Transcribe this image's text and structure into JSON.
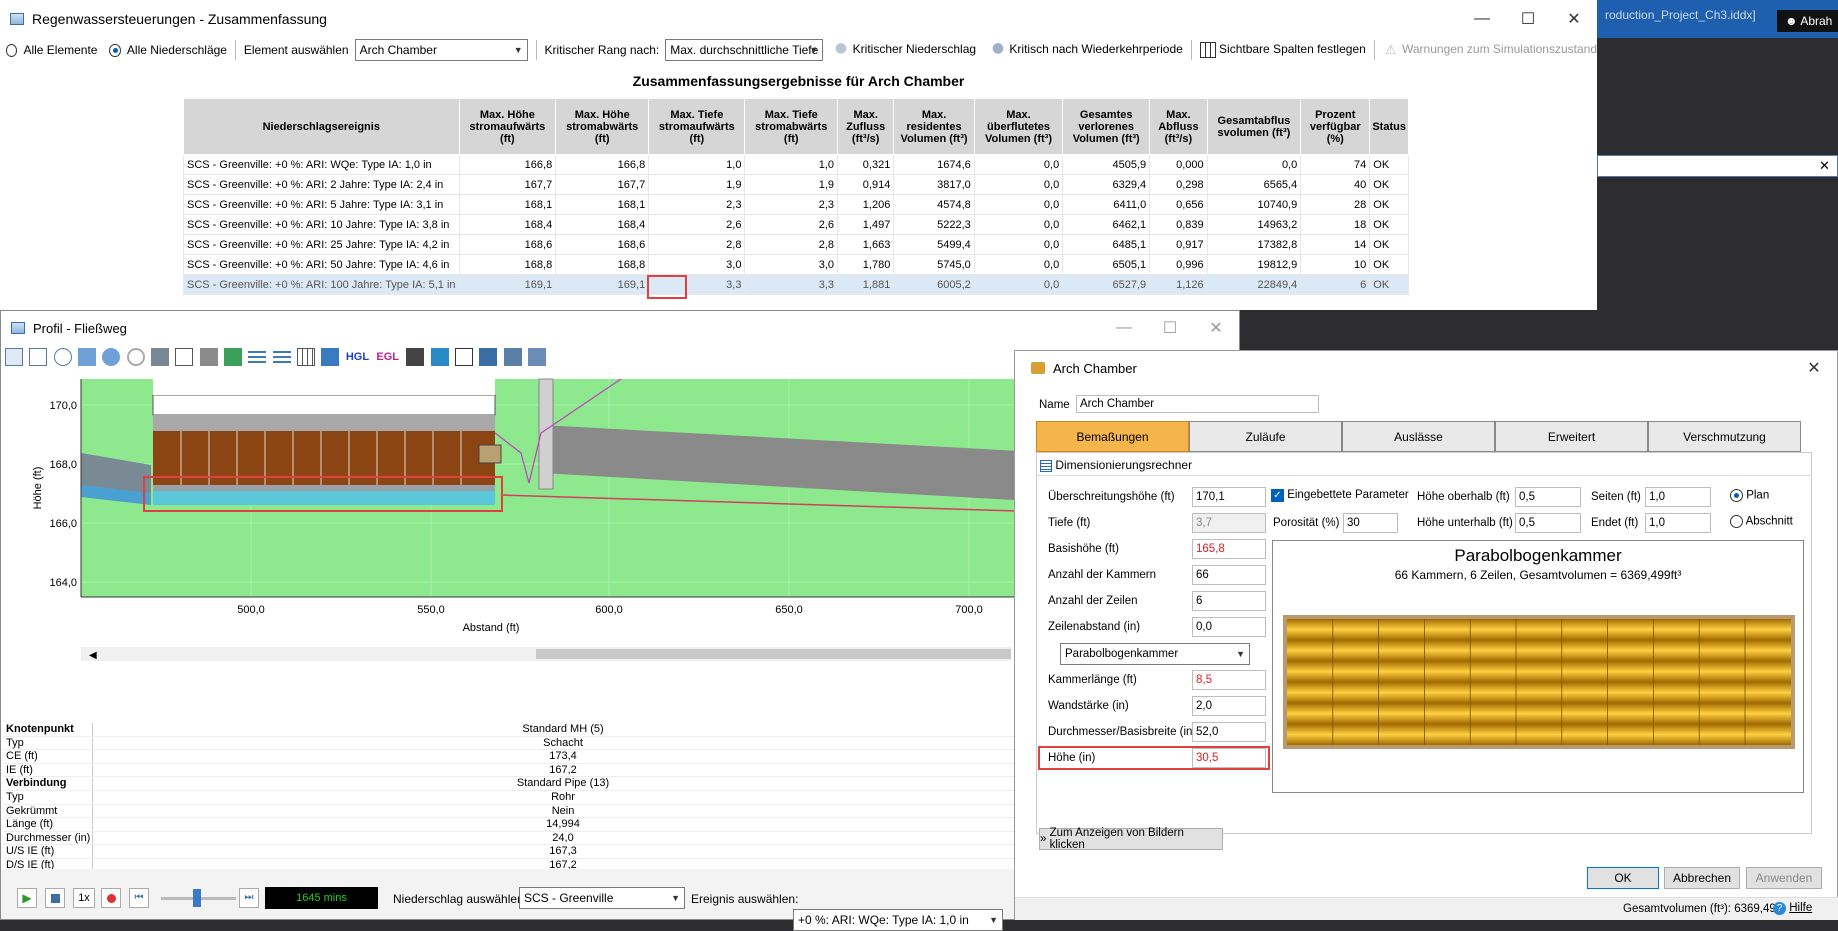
{
  "bg_window": {
    "file_text": "roduction_Project_Ch3.iddx]",
    "user_text": "Abrah"
  },
  "main": {
    "title": "Regenwassersteuerungen - Zusammenfassung",
    "radio_all_elements": "Alle Elemente",
    "radio_all_precip": "Alle Niederschläge",
    "element_label": "Element auswählen",
    "element_value": "Arch Chamber",
    "rank_label": "Kritischer Rang nach:",
    "rank_value": "Max. durchschnittliche Tiefe",
    "critical_precip": "Kritischer Niederschlag",
    "critical_return": "Kritisch nach Wiederkehrperiode",
    "visible_columns": "Sichtbare Spalten festlegen",
    "warnings": "Warnungen zum Simulationszustand",
    "table_title": "Zusammenfassungsergebnisse für Arch Chamber",
    "headers": [
      "Niederschlagsereignis",
      "Max. Höhe stromaufwärts (ft)",
      "Max. Höhe stromabwärts (ft)",
      "Max. Tiefe stromaufwärts (ft)",
      "Max. Tiefe stromabwärts (ft)",
      "Max. Zufluss (ft³/s)",
      "Max. residentes Volumen (ft³)",
      "Max. überflutetes Volumen (ft³)",
      "Gesamtes verlorenes Volumen (ft³)",
      "Max. Abfluss (ft³/s)",
      "Gesamtabflus svolumen (ft³)",
      "Prozent verfügbar (%)",
      "Status"
    ],
    "rows": [
      [
        "SCS - Greenville: +0 %: ARI: WQe: Type IA: 1,0 in",
        "166,8",
        "166,8",
        "1,0",
        "1,0",
        "0,321",
        "1674,6",
        "0,0",
        "4505,9",
        "0,000",
        "0,0",
        "74",
        "OK"
      ],
      [
        "SCS - Greenville: +0 %: ARI: 2 Jahre: Type IA: 2,4 in",
        "167,7",
        "167,7",
        "1,9",
        "1,9",
        "0,914",
        "3817,0",
        "0,0",
        "6329,4",
        "0,298",
        "6565,4",
        "40",
        "OK"
      ],
      [
        "SCS - Greenville: +0 %: ARI: 5 Jahre: Type IA: 3,1 in",
        "168,1",
        "168,1",
        "2,3",
        "2,3",
        "1,206",
        "4574,8",
        "0,0",
        "6411,0",
        "0,656",
        "10740,9",
        "28",
        "OK"
      ],
      [
        "SCS - Greenville: +0 %: ARI: 10 Jahre: Type IA: 3,8 in",
        "168,4",
        "168,4",
        "2,6",
        "2,6",
        "1,497",
        "5222,3",
        "0,0",
        "6462,1",
        "0,839",
        "14963,2",
        "18",
        "OK"
      ],
      [
        "SCS - Greenville: +0 %: ARI: 25 Jahre: Type IA: 4,2 in",
        "168,6",
        "168,6",
        "2,8",
        "2,8",
        "1,663",
        "5499,4",
        "0,0",
        "6485,1",
        "0,917",
        "17382,8",
        "14",
        "OK"
      ],
      [
        "SCS - Greenville: +0 %: ARI: 50 Jahre: Type IA: 4,6 in",
        "168,8",
        "168,8",
        "3,0",
        "3,0",
        "1,780",
        "5745,0",
        "0,0",
        "6505,1",
        "0,996",
        "19812,9",
        "10",
        "OK"
      ],
      [
        "SCS - Greenville: +0 %: ARI: 100 Jahre: Type IA: 5,1 in",
        "169,1",
        "169,1",
        "3,3",
        "3,3",
        "1,881",
        "6005,2",
        "0,0",
        "6527,9",
        "1,126",
        "22849,4",
        "6",
        "OK"
      ]
    ]
  },
  "profile": {
    "title": "Profil - Fließweg",
    "toolbar_text": [
      "HGL",
      "EGL"
    ],
    "y_label": "Höhe (ft)",
    "x_label": "Abstand (ft)",
    "y_ticks": [
      "170,0",
      "168,0",
      "166,0",
      "164,0"
    ],
    "x_ticks": [
      "500,0",
      "550,0",
      "600,0",
      "650,0",
      "700,0"
    ],
    "props": [
      [
        "Knotenpunkt",
        "Standard MH (5)",
        true
      ],
      [
        "Typ",
        "Schacht",
        false
      ],
      [
        "CE (ft)",
        "173,4",
        false
      ],
      [
        "IE (ft)",
        "167,2",
        false
      ],
      [
        "Verbindung",
        "Standard Pipe (13)",
        true
      ],
      [
        "Typ",
        "Rohr",
        false
      ],
      [
        "Gekrümmt",
        "Nein",
        false
      ],
      [
        "Länge (ft)",
        "14,994",
        false
      ],
      [
        "Durchmesser (in)",
        "24,0",
        false
      ],
      [
        "U/S IE (ft)",
        "167,3",
        false
      ],
      [
        "D/S IE (ft)",
        "167,2",
        false
      ]
    ],
    "speed": "1x",
    "time": "1645 mins",
    "precip_label": "Niederschlag auswählen:",
    "precip_value": "SCS - Greenville",
    "event_label": "Ereignis auswählen:",
    "event_value": "+0 %: ARI: WQe: Type IA: 1,0 in"
  },
  "dialog": {
    "title": "Arch Chamber",
    "name_label": "Name",
    "name_value": "Arch Chamber",
    "tabs": [
      "Bemaßungen",
      "Zuläufe",
      "Auslässe",
      "Erweitert",
      "Verschmutzung"
    ],
    "sizing_calc": "Dimensionierungsrechner",
    "fields": {
      "overflow_label": "Überschreitungshöhe (ft)",
      "overflow": "170,1",
      "depth_label": "Tiefe (ft)",
      "depth": "3,7",
      "base_label": "Basishöhe (ft)",
      "base": "165,8",
      "chambers_label": "Anzahl der Kammern",
      "chambers": "66",
      "rows_label": "Anzahl der Zeilen",
      "rows": "6",
      "row_spacing_label": "Zeilenabstand (in)",
      "row_spacing": "0,0",
      "chamber_type": "Parabolbogenkammer",
      "chamber_len_label": "Kammerlänge (ft)",
      "chamber_len": "8,5",
      "wall_label": "Wandstärke (in)",
      "wall": "2,0",
      "diam_label": "Durchmesser/Basisbreite (in)",
      "diam": "52,0",
      "height_label": "Höhe (in)",
      "height": "30,5",
      "embedded_label": "Eingebettete Parameter",
      "porosity_label": "Porosität (%)",
      "porosity": "30",
      "height_above_label": "Höhe oberhalb (ft)",
      "height_above": "0,5",
      "height_below_label": "Höhe unterhalb (ft)",
      "height_below": "0,5",
      "sides_label": "Seiten (ft)",
      "sides": "1,0",
      "ends_label": "Endet (ft)",
      "ends": "1,0",
      "plan": "Plan",
      "section": "Abschnitt"
    },
    "preview_title": "Parabolbogenkammer",
    "preview_sub": "66 Kammern, 6 Zeilen, Gesamtvolumen = 6369,499ft³",
    "show_images": "Zum Anzeigen von Bildern klicken",
    "ok": "OK",
    "cancel": "Abbrechen",
    "apply": "Anwenden",
    "total_volume": "Gesamtvolumen (ft³): 6369,499",
    "help": "Hilfe"
  },
  "colors": {
    "accent": "#0060c0",
    "tab_active": "#f5b54a",
    "highlight": "#e04040",
    "chart_bg": "#8ee88e"
  }
}
